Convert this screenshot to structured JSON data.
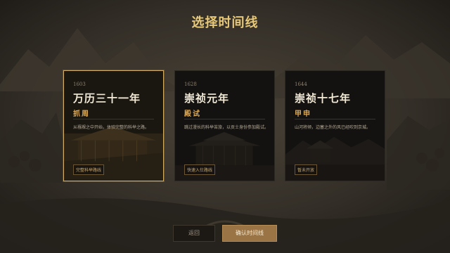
{
  "page": {
    "title": "选择时间线"
  },
  "cards": [
    {
      "year": "1603",
      "name": "万历三十一年",
      "subtitle": "抓周",
      "description": "从襁褓之中开始，体验完整的科举之路。",
      "tag": "完整科举路线",
      "selected": true
    },
    {
      "year": "1628",
      "name": "崇祯元年",
      "subtitle": "殿试",
      "description": "跳过漫长的科举苦旅，以贡士身份参加殿试。",
      "tag": "快速入仕路线",
      "selected": false
    },
    {
      "year": "1644",
      "name": "崇祯十七年",
      "subtitle": "甲申",
      "description": "山河将倾，边塞之外的风已经吹到京城。",
      "tag": "暂未开放",
      "selected": false
    }
  ],
  "buttons": {
    "back": "返回",
    "confirm": "确认时间线"
  },
  "colors": {
    "accent": "#d3ad62",
    "gold_text": "#e8c979",
    "confirm_bg": "#9a7444"
  }
}
